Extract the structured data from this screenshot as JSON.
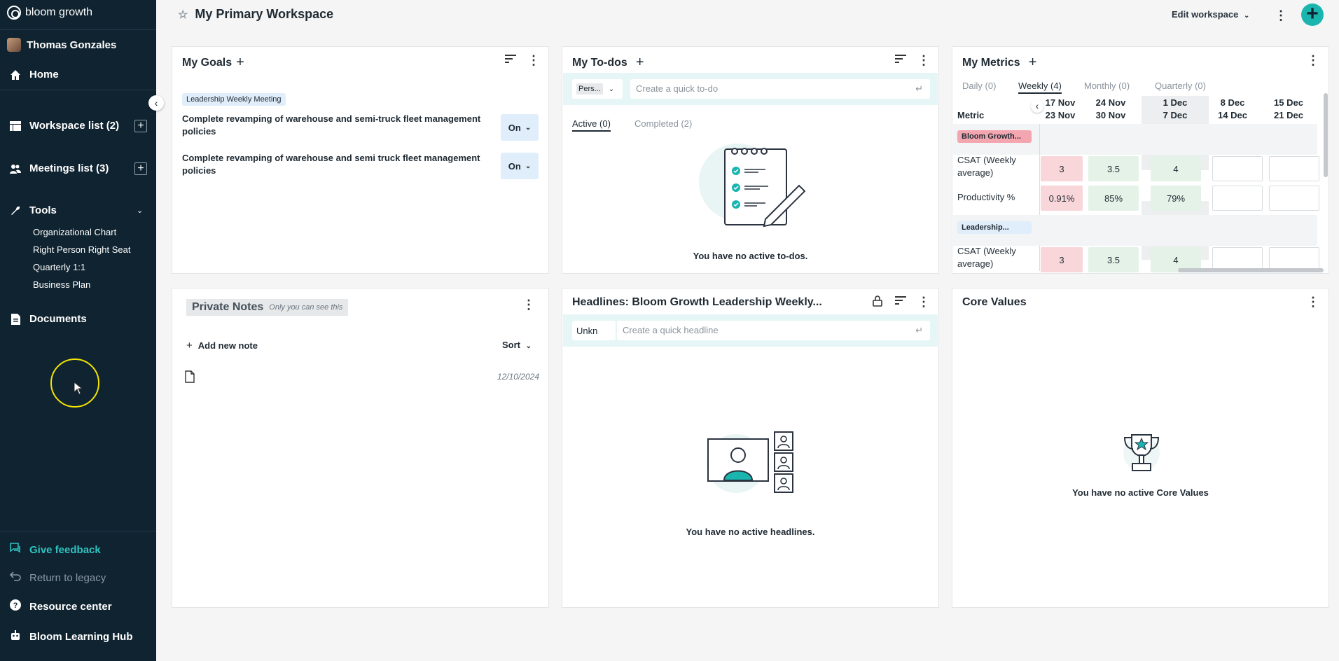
{
  "brand": {
    "name": "bloom growth"
  },
  "user": {
    "name": "Thomas Gonzales"
  },
  "sidebar": {
    "home": "Home",
    "workspace_list": "Workspace list (2)",
    "meetings_list": "Meetings list (3)",
    "tools": "Tools",
    "tool_items": [
      "Organizational Chart",
      "Right Person Right Seat",
      "Quarterly 1:1",
      "Business Plan"
    ],
    "documents": "Documents",
    "give_feedback": "Give feedback",
    "return_legacy": "Return to legacy",
    "resource_center": "Resource center",
    "learning_hub": "Bloom Learning Hub"
  },
  "header": {
    "title": "My Primary Workspace",
    "edit_label": "Edit workspace"
  },
  "goals": {
    "title": "My Goals",
    "meeting_tag": "Leadership Weekly Meeting",
    "items": [
      {
        "text": "Complete revamping of warehouse and semi-truck fleet management policies",
        "status": "On"
      },
      {
        "text": "Complete revamping of warehouse and semi truck fleet management policies",
        "status": "On"
      }
    ]
  },
  "todos": {
    "title": "My To-dos",
    "select_value": "Pers...",
    "placeholder": "Create a quick to-do",
    "tab_active": "Active (0)",
    "tab_completed": "Completed (2)",
    "empty": "You have no active to-dos."
  },
  "metrics": {
    "title": "My Metrics",
    "tabs": [
      "Daily (0)",
      "Weekly (4)",
      "Monthly (0)",
      "Quarterly (0)"
    ],
    "metric_header": "Metric",
    "weeks": [
      {
        "l1": "17 Nov",
        "l2": "23 Nov"
      },
      {
        "l1": "24 Nov",
        "l2": "30 Nov"
      },
      {
        "l1": "1 Dec",
        "l2": "7 Dec"
      },
      {
        "l1": "8 Dec",
        "l2": "14 Dec"
      },
      {
        "l1": "15 Dec",
        "l2": "21 Dec"
      }
    ],
    "group1": "Bloom Growth...",
    "group2": "Leadership...",
    "rows": [
      {
        "label": "CSAT (Weekly average)",
        "values": [
          "3",
          "3.5",
          "4",
          "",
          ""
        ]
      },
      {
        "label": "Productivity %",
        "values": [
          "0.91%",
          "85%",
          "79%",
          "",
          ""
        ]
      },
      {
        "label": "CSAT (Weekly average)",
        "values": [
          "3",
          "3.5",
          "4",
          "",
          ""
        ]
      }
    ]
  },
  "notes": {
    "title": "Private Notes",
    "subtitle": "Only you can see this",
    "add_label": "Add new note",
    "sort_label": "Sort",
    "note_date": "12/10/2024"
  },
  "headlines": {
    "title": "Headlines: Bloom Growth Leadership Weekly...",
    "select_value": "Unkn",
    "placeholder": "Create a quick headline",
    "empty": "You have no active headlines."
  },
  "core_values": {
    "title": "Core Values",
    "empty": "You have no active Core Values"
  },
  "colors": {
    "sidebar": "#0f2330",
    "accent": "#1bb5b0",
    "feedback": "#2ec4c0"
  }
}
